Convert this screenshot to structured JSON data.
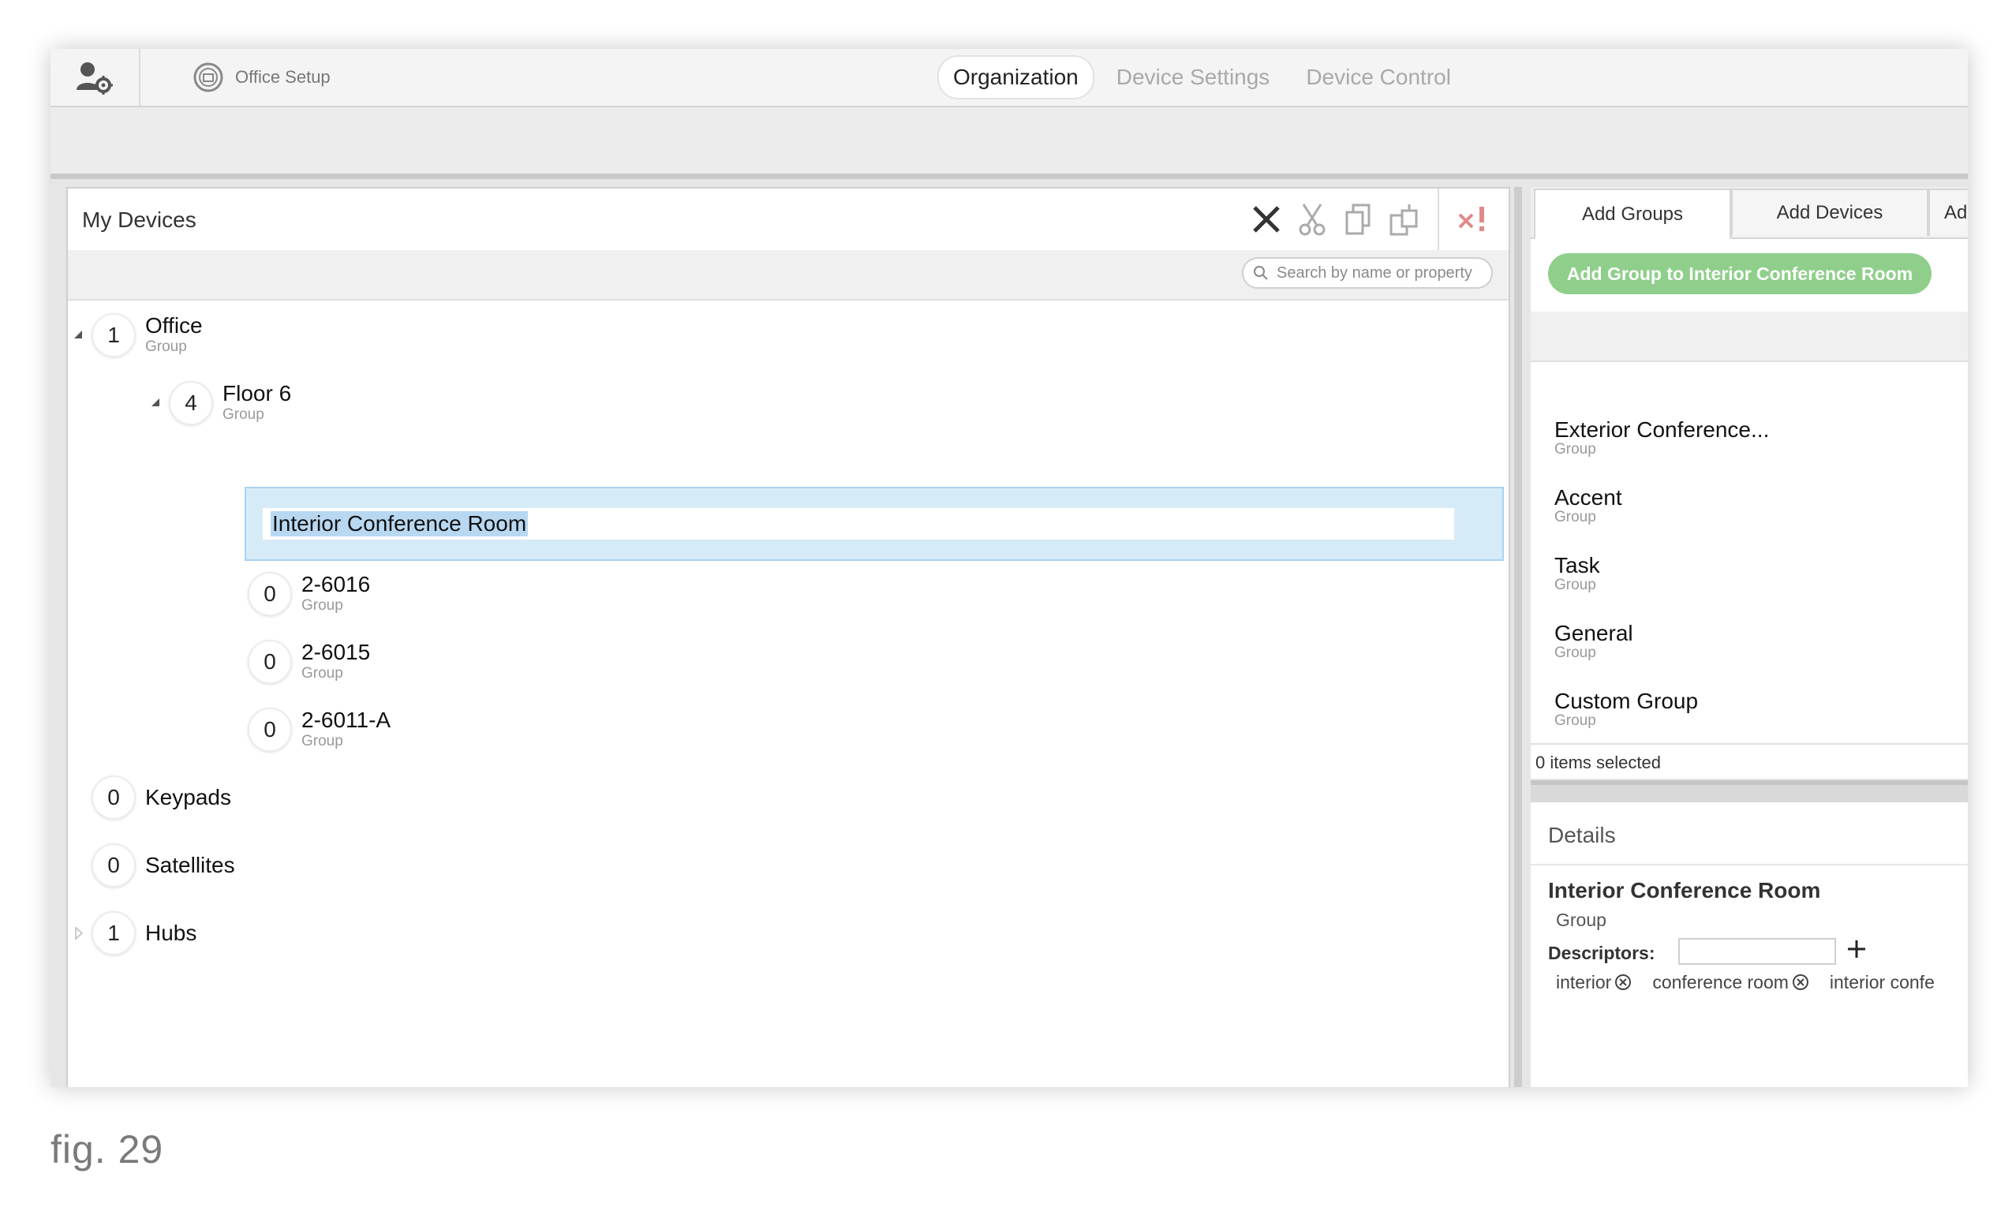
{
  "topbar": {
    "breadcrumb": "Office Setup",
    "nav_tabs": [
      "Organization",
      "Device Settings",
      "Device Control"
    ],
    "active_tab": "Organization"
  },
  "left_panel": {
    "title": "My Devices",
    "search_placeholder": "Search by name or property",
    "tree": {
      "office": {
        "count": "1",
        "name": "Office",
        "sub": "Group"
      },
      "floor6": {
        "count": "4",
        "name": "Floor 6",
        "sub": "Group"
      },
      "rename_value": "Interior Conference Room",
      "g6016": {
        "count": "0",
        "name": "2-6016",
        "sub": "Group"
      },
      "g6015": {
        "count": "0",
        "name": "2-6015",
        "sub": "Group"
      },
      "g6011a": {
        "count": "0",
        "name": "2-6011-A",
        "sub": "Group"
      },
      "keypads": {
        "count": "0",
        "name": "Keypads"
      },
      "satellites": {
        "count": "0",
        "name": "Satellites"
      },
      "hubs": {
        "count": "1",
        "name": "Hubs"
      }
    }
  },
  "right_panel": {
    "tabs": [
      "Add Groups",
      "Add Devices",
      "Ad"
    ],
    "add_button": "Add Group to Interior Conference Room",
    "items": [
      {
        "name": "Exterior Conference...",
        "sub": "Group"
      },
      {
        "name": "Accent",
        "sub": "Group"
      },
      {
        "name": "Task",
        "sub": "Group"
      },
      {
        "name": "General",
        "sub": "Group"
      },
      {
        "name": "Custom Group",
        "sub": "Group"
      }
    ],
    "status": "0 items selected"
  },
  "details": {
    "title": "Details",
    "name": "Interior Conference Room",
    "type": "Group",
    "descriptors_label": "Descriptors:",
    "tags": [
      "interior",
      "conference room",
      "interior confe"
    ]
  },
  "caption": "fig. 29",
  "colors": {
    "accent_green": "#8fcf8b",
    "selection_blue": "#d6ebf8",
    "delete_red": "#e08a8a"
  }
}
